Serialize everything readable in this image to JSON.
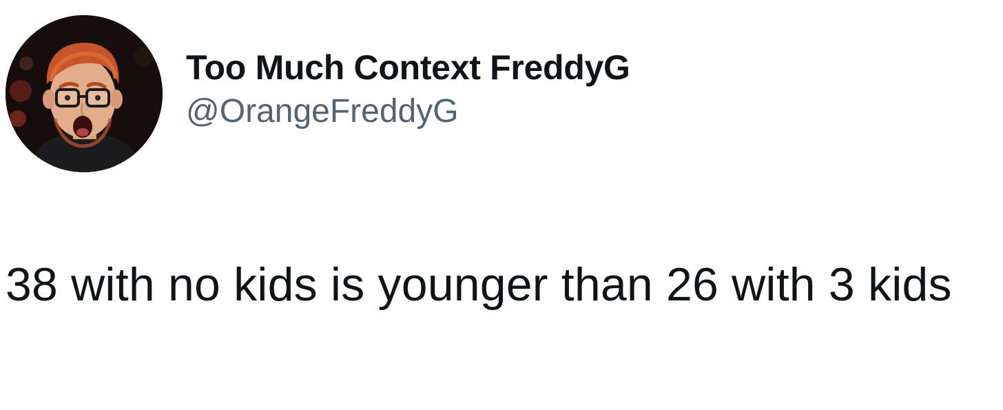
{
  "tweet": {
    "author": {
      "display_name": "Too Much Context FreddyG",
      "handle": "@OrangeFreddyG"
    },
    "text": "38 with no kids is younger than 26 with 3 kids"
  }
}
